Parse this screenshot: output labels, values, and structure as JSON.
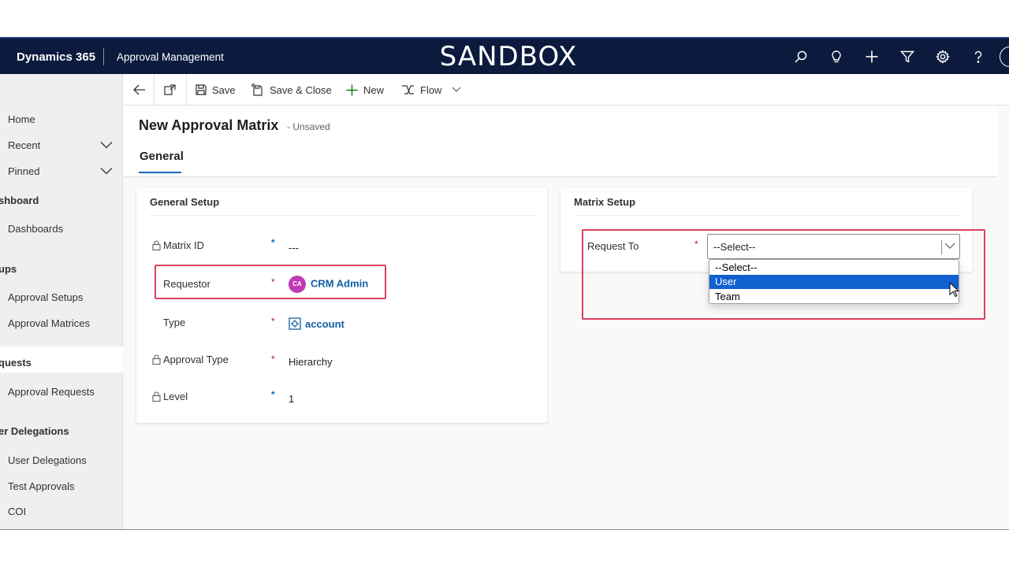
{
  "topbar": {
    "brand": "Dynamics 365",
    "app_name": "Approval Management",
    "environment": "SANDBOX",
    "icons": [
      "search-icon",
      "lightbulb-icon",
      "plus-icon",
      "filter-icon",
      "gear-icon",
      "help-icon"
    ]
  },
  "sidebar": {
    "items": {
      "home": "Home",
      "recent": "Recent",
      "pinned": "Pinned",
      "group_dashboard": "shboard",
      "dashboards": "Dashboards",
      "group_setups": "ups",
      "approval_setups": "Approval Setups",
      "approval_matrices": "Approval Matrices",
      "group_requests": "quests",
      "approval_requests": "Approval Requests",
      "group_delegations": "er Delegations",
      "user_delegations": "User Delegations",
      "test_approvals": "Test Approvals",
      "coi": "COI"
    },
    "active": "Approval Matrices"
  },
  "commandbar": {
    "save": "Save",
    "save_close": "Save & Close",
    "new": "New",
    "flow": "Flow"
  },
  "header": {
    "title": "New Approval Matrix",
    "status": "- Unsaved",
    "tab": "General"
  },
  "general_setup": {
    "title": "General Setup",
    "fields": {
      "matrix_id": {
        "label": "Matrix ID",
        "marker": "*",
        "value": "---"
      },
      "requestor": {
        "label": "Requestor",
        "marker": "*",
        "value": "CRM Admin",
        "initials": "CA"
      },
      "type": {
        "label": "Type",
        "marker": "*",
        "value": "account"
      },
      "approval_type": {
        "label": "Approval Type",
        "marker": "*",
        "value": "Hierarchy"
      },
      "level": {
        "label": "Level",
        "marker": "*",
        "value": "1"
      }
    }
  },
  "matrix_setup": {
    "title": "Matrix Setup",
    "request_to": {
      "label": "Request To",
      "marker": "*",
      "value": "--Select--",
      "options": [
        "--Select--",
        "User",
        "Team"
      ],
      "highlighted": "User"
    }
  },
  "colors": {
    "topbar": "#0b1a3d",
    "highlight_box": "#d9415e",
    "dropdown_selected": "#1060d0",
    "avatar": "#c239b3",
    "link": "#115ea3"
  }
}
